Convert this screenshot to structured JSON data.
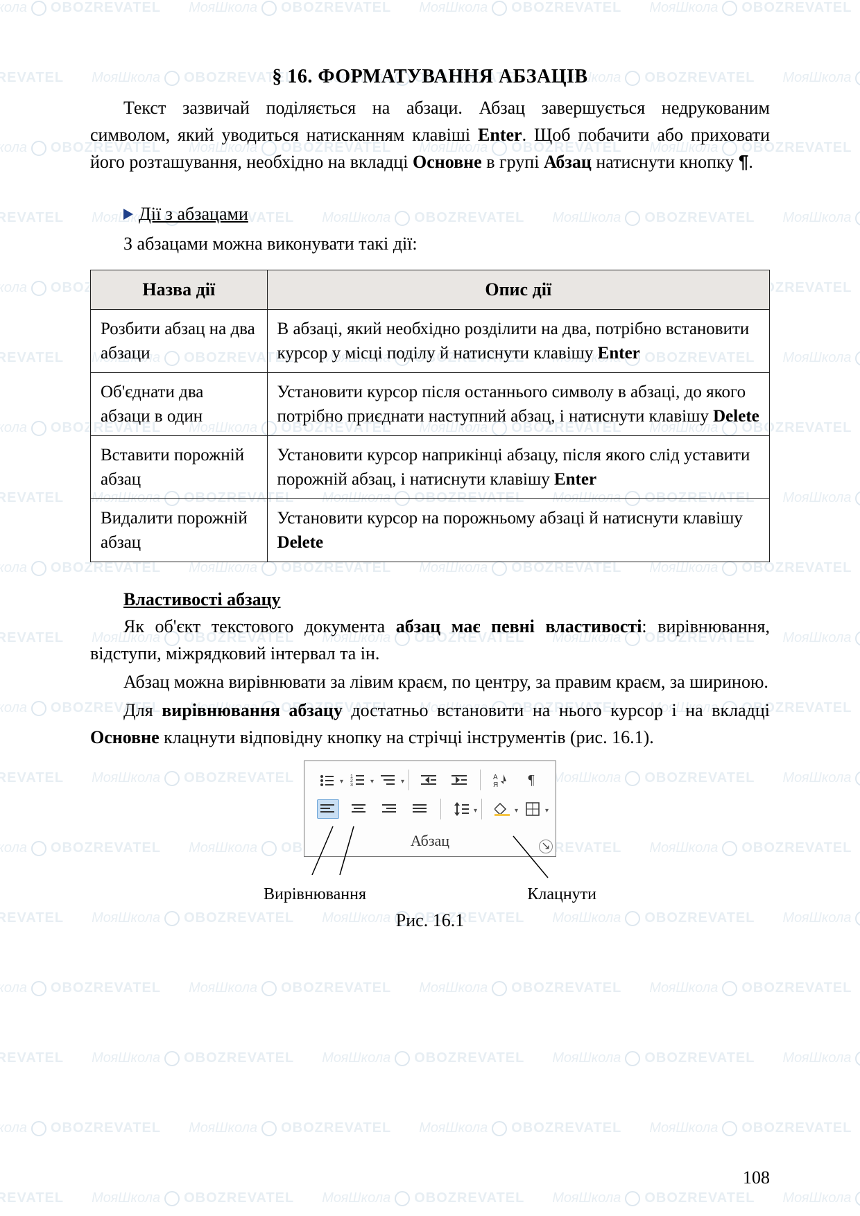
{
  "watermark": {
    "text1": "МояШкола",
    "text2": "OBOZREVATEL"
  },
  "title": "§ 16. ФОРМАТУВАННЯ АБЗАЦІВ",
  "intro": {
    "p1_a": "Текст зазвичай поділяється на абзаци. Абзац завершується недрукованим символом, який уводиться натисканням клавіші ",
    "p1_enter": "Enter",
    "p1_b": ". Щоб побачити або приховати його розташування, необхідно на вкладці ",
    "p1_tab": "Основне",
    "p1_c": " в групі ",
    "p1_group": "Абзац",
    "p1_d": " натиснути кнопку ",
    "p1_e": "."
  },
  "sub1": "Дії з абзацами",
  "sub1_line": "З абзацами можна виконувати такі дії:",
  "table": {
    "h1": "Назва дії",
    "h2": "Опис дії",
    "rows": [
      {
        "name": "Розбити абзац на два абзаци",
        "desc_a": "В абзаці, який необхідно розділити на два, потрібно встановити курсор у місці поділу й натиснути клавішу ",
        "desc_bold": "Enter",
        "desc_b": ""
      },
      {
        "name": "Об'єднати два абзаци в один",
        "desc_a": "Установити курсор після останнього символу в абзаці, до якого потрібно приєднати наступний абзац, і натиснути клавішу ",
        "desc_bold": "Delete",
        "desc_b": ""
      },
      {
        "name": "Вставити порожній абзац",
        "desc_a": "Установити курсор наприкінці абзацу, після якого слід уставити порожній абзац, і натиснути клавішу ",
        "desc_bold": "Enter",
        "desc_b": ""
      },
      {
        "name": "Видалити порожній абзац",
        "desc_a": "Установити курсор на порожньому абзаці й натиснути клавішу ",
        "desc_bold": "Delete",
        "desc_b": ""
      }
    ]
  },
  "sub2": "Властивості абзацу",
  "body2": {
    "p1_a": "Як об'єкт текстового документа ",
    "p1_bold": "абзац має певні властивості",
    "p1_b": ": вирівнювання, відступи, міжрядковий інтервал та ін.",
    "p2": "Абзац можна вирівнювати за лівим краєм, по центру, за правим краєм, за шириною.",
    "p3_a": "Для ",
    "p3_bold1": "вирівнювання абзацу",
    "p3_b": " достатньо встановити на нього курсор і на вкладці ",
    "p3_bold2": "Основне",
    "p3_c": " клацнути відповідну кнопку на стрічці інструментів (рис. 16.1)."
  },
  "ribbon": {
    "label": "Абзац",
    "callout_left": "Вирівнювання",
    "callout_right": "Клацнути"
  },
  "fig_caption": "Рис. 16.1",
  "page_num": "108"
}
